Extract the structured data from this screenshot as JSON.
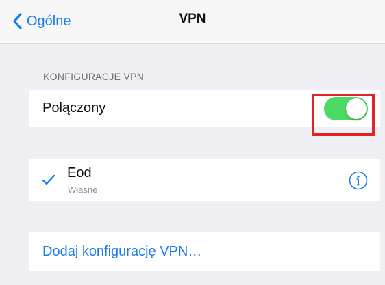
{
  "navbar": {
    "back_label": "Ogólne",
    "title": "VPN"
  },
  "section": {
    "header": "KONFIGURACJE VPN"
  },
  "status_row": {
    "label": "Połączony",
    "toggle_on": true
  },
  "vpn_config": {
    "name": "Eod",
    "type": "Własne",
    "selected": true
  },
  "add_config": {
    "label": "Dodaj konfigurację VPN…"
  },
  "colors": {
    "accent": "#1a7cf0",
    "toggle_on": "#4cd964",
    "highlight": "#e32228",
    "background": "#efeff4"
  },
  "icons": {
    "back": "chevron-left-icon",
    "selected": "checkmark-icon",
    "info": "info-circle-icon"
  }
}
